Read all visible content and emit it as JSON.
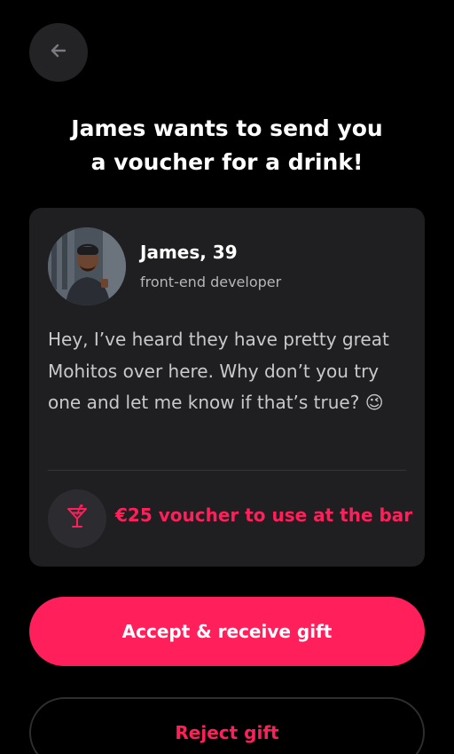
{
  "header": {
    "back_icon": "arrow-left-icon",
    "title_line1": "James wants to send you",
    "title_line2": "a voucher for a drink!"
  },
  "card": {
    "sender_name": "James, 39",
    "sender_role": "front-end developer",
    "avatar_icon": "profile-photo",
    "message": "Hey, I’ve heard they have pretty great Mohitos over here. Why don’t you try one and let me know if that’s true? 😉",
    "voucher_icon": "cocktail-glass-icon",
    "voucher_text": "€25 voucher to use at the bar"
  },
  "actions": {
    "accept_label": "Accept & receive gift",
    "reject_label": "Reject gift"
  },
  "colors": {
    "accent": "#ff1f5a",
    "background": "#000000",
    "card": "#1f1f22"
  }
}
